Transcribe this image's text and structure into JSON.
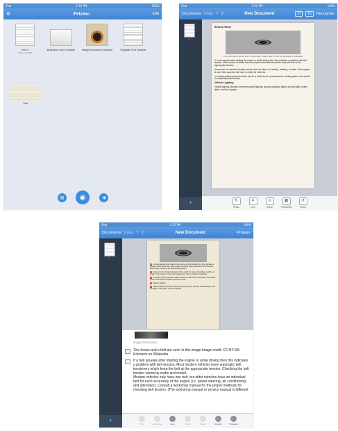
{
  "status": {
    "carrier": "iPad",
    "time": "1:55 PM",
    "battery": "100%"
  },
  "screen1": {
    "nav": {
      "left_icon": "gear-icon",
      "title": "Prizmo",
      "right": "Edit"
    },
    "docs": [
      {
        "label": "Text 2",
        "sub": "Today, 1:49 PM",
        "kind": "doc"
      },
      {
        "label": "Business Card Sample",
        "sub": "",
        "kind": "card"
      },
      {
        "label": "Image Extraction Sample",
        "sub": "",
        "kind": "pipe"
      },
      {
        "label": "Regular Text Sample",
        "sub": "",
        "kind": "news"
      }
    ],
    "note_label": "Text",
    "buttons": {
      "left": "doc-icon",
      "center": "camera-icon",
      "right": "speaker-icon"
    }
  },
  "screen2": {
    "nav": {
      "back": "Documents",
      "undo": "Undo",
      "title": "New Document",
      "actions": [
        "AT",
        "En"
      ],
      "recognize": "Recognize"
    },
    "page_number": "1",
    "doc": {
      "heading": "Belts & Hoses",
      "caption": "Two hoses and a belt as seen in this image. Image credit: CC-BY-SA-Kolossos on Wikipedia",
      "paragraphs": [
        "If a belt squeals after starting the engine or while driving then this indicates a problem with belt tension. Most modern vehicles have automatic belt tensioners which keep the belt at the appropriate tension.",
        "Hoses can be checked visually and by touch for signs of cracking, swelling, or leaks. If the engine is cool, then squeeze the hose to check for softness.",
        "In cooling system pressure tester can be a useful tool to pressurize the cooling system and check for leaks at junction hoses."
      ],
      "subheading": "Vehicle Lighting",
      "last_para": "Vehicle lighting includes instrument panel lighting, warning indicator lights, and tail lights, brake lights, and turn signals."
    },
    "tools": [
      {
        "icon": "rotate-icon",
        "label": "Rotate"
      },
      {
        "icon": "crop-icon",
        "label": "Crop"
      },
      {
        "icon": "adjust-icon",
        "label": "Adjust"
      },
      {
        "icon": "readability-icon",
        "label": "Readability"
      },
      {
        "icon": "reset-icon",
        "label": "Reset"
      }
    ]
  },
  "screen3": {
    "nav": {
      "back": "Documents",
      "undo": "Undo",
      "title": "New Document",
      "prepare": "Prepare"
    },
    "page_number": "1",
    "image_description": "Image Description",
    "text_blocks": [
      "Two hoses and a belt are seen in this image Image credit: CC-BY-SA-Kolossos on Wikipedia",
      "If a belt squeals after starting the engine or while driving then this indicates a problem with belt tension. Most modern vehicles have automatic belt tensioners which keep the belt at the appropriate tension. Checking the belt tension varies by make and model.\nModern vehicles only have one belt, but older vehicles have an individual belt for each accessory of the engine (i.e. power steering, air conditioning and alternator). Consult a workshop manual for the proper methods for checking belt tension. (The workshop manual or service manual is different"
    ],
    "tools": [
      {
        "icon": "text-icon",
        "label": "Text",
        "on": false
      },
      {
        "icon": "language-icon",
        "label": "Language",
        "on": false
      },
      {
        "icon": "auto-icon",
        "label": "Auto",
        "on": true
      },
      {
        "icon": "picture-icon",
        "label": "Picture",
        "on": false
      },
      {
        "icon": "delete-icon",
        "label": "Delete",
        "on": false
      },
      {
        "icon": "reorder-icon",
        "label": "Reorder",
        "on": true
      },
      {
        "icon": "translate-icon",
        "label": "Translate",
        "on": true
      }
    ]
  }
}
